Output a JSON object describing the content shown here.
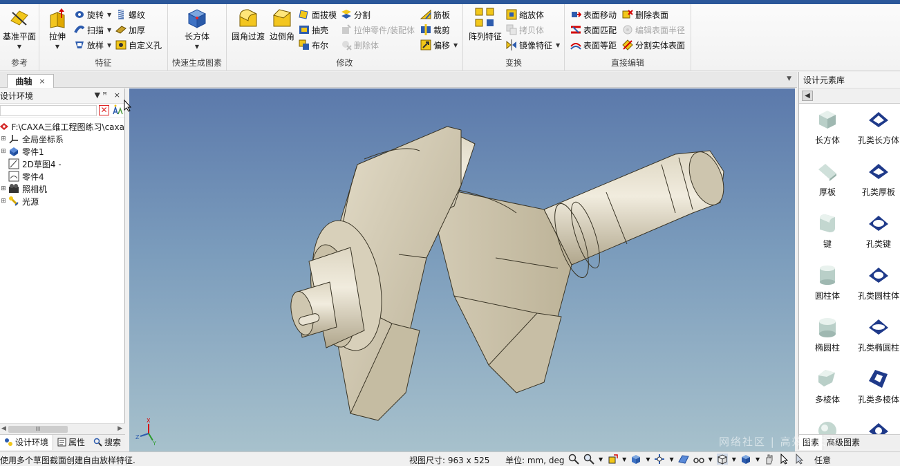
{
  "ribbon": {
    "groups": {
      "reference": "参考",
      "feature": "特征",
      "quick": "快速生成图素",
      "modify": "修改",
      "transform": "变换",
      "direct_edit": "直接编辑"
    },
    "buttons": {
      "datum_plane": "基准平面",
      "extrude": "拉伸",
      "revolve": "旋转",
      "sweep": "扫描",
      "loft": "放样",
      "thread": "螺纹",
      "thicken": "加厚",
      "custom_hole": "自定义孔",
      "cuboid": "长方体",
      "fillet": "圆角过渡",
      "chamfer": "边倒角",
      "draft": "面拔模",
      "shell": "抽壳",
      "boolean": "布尔",
      "split": "分割",
      "extrude_part": "拉伸零件/装配体",
      "delete_body": "删除体",
      "rib": "筋板",
      "trim": "裁剪",
      "offset": "偏移",
      "pattern": "阵列特征",
      "scale": "缩放体",
      "copy_body": "拷贝体",
      "mirror": "镜像特征",
      "move_face": "表面移动",
      "match_face": "表面匹配",
      "equidistant_face": "表面等距",
      "delete_face": "删除表面",
      "edit_face_radius": "编辑表面半径",
      "split_solid_face": "分割实体表面"
    }
  },
  "document": {
    "tab_label": "曲轴",
    "close_glyph": "×",
    "dropdown_glyph": "▼"
  },
  "left_panel": {
    "title": "设计环境",
    "pin_glyph": "▼  ꟸ",
    "close_glyph": "×",
    "tree": [
      {
        "label": "F:\\CAXA三维工程图练习\\caxa",
        "icon": "caxa-root-icon",
        "expander": ""
      },
      {
        "label": "全局坐标系",
        "icon": "coordinate-system-icon",
        "expander": "⊞"
      },
      {
        "label": "零件1",
        "icon": "part-icon",
        "expander": "⊞"
      },
      {
        "label": "2D草图4 -",
        "icon": "sketch-icon",
        "expander": ""
      },
      {
        "label": "零件4",
        "icon": "part-sketch-icon",
        "expander": ""
      },
      {
        "label": "照相机",
        "icon": "camera-icon",
        "expander": "⊞"
      },
      {
        "label": "光源",
        "icon": "light-icon",
        "expander": "⊞"
      }
    ],
    "scroll_thumb_glyph": "III",
    "tabs": [
      "设计环境",
      "属性",
      "搜索"
    ]
  },
  "right_panel": {
    "title": "设计元素库",
    "back_glyph": "◀",
    "items": [
      {
        "label": "长方体",
        "icon": "cuboid-icon"
      },
      {
        "label": "孔类长方体",
        "icon": "hole-cuboid-icon"
      },
      {
        "label": "厚板",
        "icon": "plate-icon"
      },
      {
        "label": "孔类厚板",
        "icon": "hole-plate-icon"
      },
      {
        "label": "键",
        "icon": "key-icon"
      },
      {
        "label": "孔类键",
        "icon": "hole-key-icon"
      },
      {
        "label": "圆柱体",
        "icon": "cylinder-icon"
      },
      {
        "label": "孔类圆柱体",
        "icon": "hole-cylinder-icon"
      },
      {
        "label": "椭圆柱",
        "icon": "elliptic-cylinder-icon"
      },
      {
        "label": "孔类椭圆柱",
        "icon": "hole-elliptic-cylinder-icon"
      },
      {
        "label": "多棱体",
        "icon": "prism-icon"
      },
      {
        "label": "孔类多棱体",
        "icon": "hole-prism-icon"
      }
    ],
    "tabs": [
      "图素",
      "高级图素"
    ]
  },
  "viewport": {
    "axis_labels": {
      "x": "X",
      "y": "Y",
      "z": "Z"
    }
  },
  "status": {
    "message": "使用多个草图截面创建自由放样特征.",
    "view_size": "视图尺寸: 963 x 525",
    "units": "单位: mm, deg",
    "pick_mode": "任意"
  },
  "watermark": "网络社区 | 高效的天方",
  "colors": {
    "title_bar": "#2b579a",
    "part_face": "#cfc7b2",
    "viewport_top": "#5b79ab",
    "viewport_bottom": "#a7c1cc"
  }
}
